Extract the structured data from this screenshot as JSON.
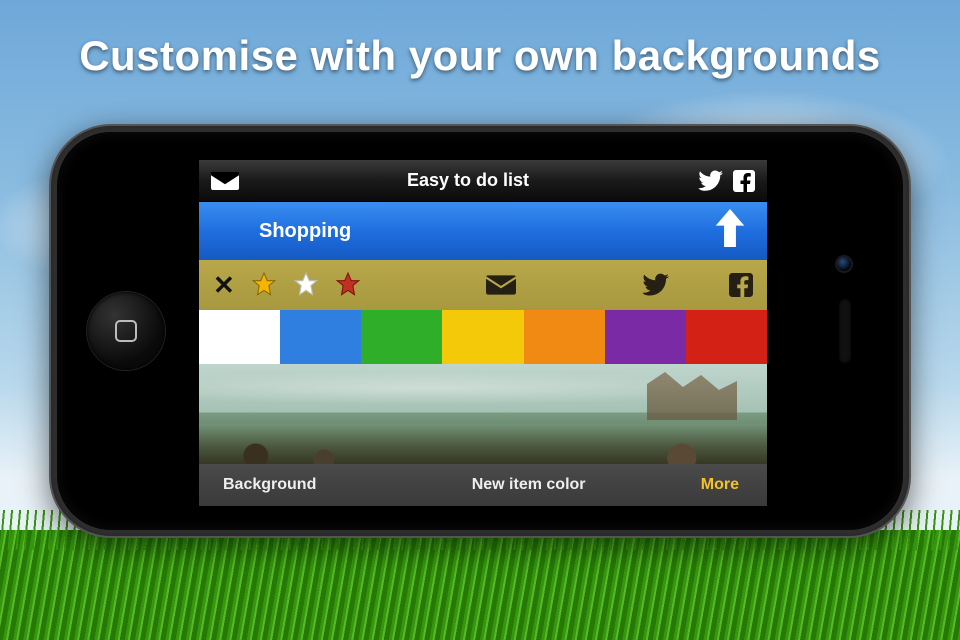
{
  "headline": "Customise with your own backgrounds",
  "topbar": {
    "title": "Easy to do list",
    "mail_icon": "mail-icon",
    "twitter_icon": "twitter-icon",
    "facebook_icon": "facebook-icon"
  },
  "list_header": {
    "title": "Shopping",
    "action_icon": "arrow-up-icon"
  },
  "item_toolbar": {
    "close_label": "✕",
    "stars": [
      {
        "name": "star-gold",
        "color": "#f4b400"
      },
      {
        "name": "star-white",
        "color": "#ffffff"
      },
      {
        "name": "star-red",
        "color": "#c23022"
      }
    ],
    "share": [
      {
        "name": "mail-icon"
      },
      {
        "name": "twitter-icon"
      },
      {
        "name": "facebook-icon"
      }
    ]
  },
  "color_swatches": [
    {
      "name": "white",
      "hex": "#ffffff"
    },
    {
      "name": "blue",
      "hex": "#2f7fe0"
    },
    {
      "name": "green",
      "hex": "#2fae2a"
    },
    {
      "name": "yellow",
      "hex": "#f4c90a"
    },
    {
      "name": "orange",
      "hex": "#f08a12"
    },
    {
      "name": "purple",
      "hex": "#7a2aa5"
    },
    {
      "name": "red",
      "hex": "#d42115"
    }
  ],
  "bottom_tabs": {
    "background": "Background",
    "new_item_color": "New item color",
    "more": "More",
    "selected": "more"
  }
}
